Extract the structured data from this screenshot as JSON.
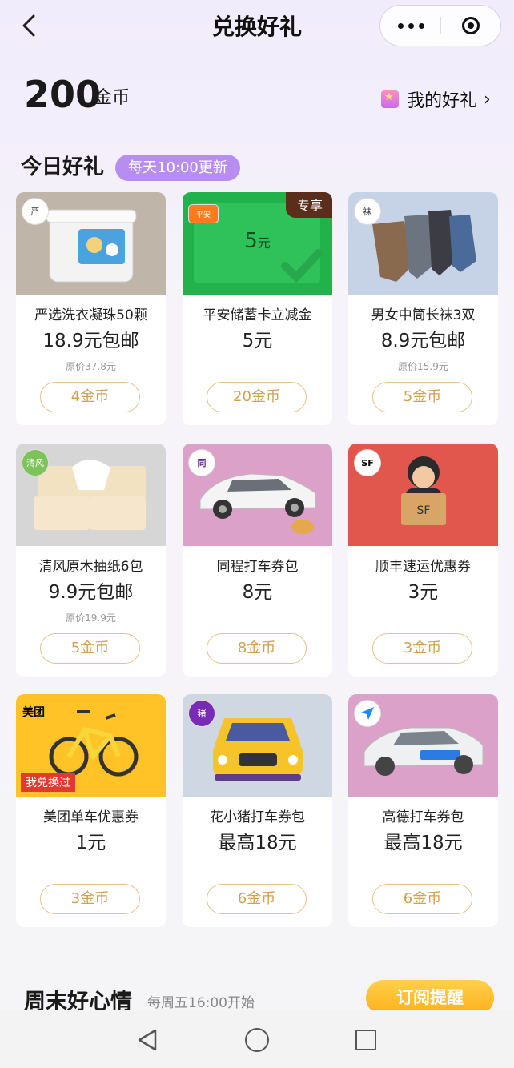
{
  "header": {
    "title": "兑换好礼"
  },
  "balance": {
    "amount": "200",
    "unit": "金币",
    "my_gifts_label": "我的好礼"
  },
  "section_today": {
    "title": "今日好礼",
    "badge": "每天10:00更新"
  },
  "products": [
    {
      "name": "严选洗衣凝珠50颗",
      "price": "18.9元包邮",
      "original": "原价37.8元",
      "cost": "4金币",
      "bg": "#bfb5a8"
    },
    {
      "name": "平安储蓄卡立减金",
      "price": "5元",
      "original": "",
      "cost": "20金币",
      "badge": "专享",
      "bg": "#22b24c",
      "voucher": "5",
      "voucher_unit": "元"
    },
    {
      "name": "男女中筒长袜3双",
      "price": "8.9元包邮",
      "original": "原价15.9元",
      "cost": "5金币",
      "bg": "#c6d2e6"
    },
    {
      "name": "清风原木抽纸6包",
      "price": "9.9元包邮",
      "original": "原价19.9元",
      "cost": "5金币",
      "bg": "#d6d6d6"
    },
    {
      "name": "同程打车券包",
      "price": "8元",
      "original": "",
      "cost": "8金币",
      "bg": "#dba1c9"
    },
    {
      "name": "顺丰速运优惠券",
      "price": "3元",
      "original": "",
      "cost": "3金币",
      "bg": "#e2574d"
    },
    {
      "name": "美团单车优惠券",
      "price": "1元",
      "original": "",
      "cost": "3金币",
      "badge": "我兑换过",
      "logo": "美团",
      "bg": "#ffc227"
    },
    {
      "name": "花小猪打车券包",
      "price": "最高18元",
      "original": "",
      "cost": "6金币",
      "bg": "#cfd7e2"
    },
    {
      "name": "高德打车券包",
      "price": "最高18元",
      "original": "",
      "cost": "6金币",
      "bg": "#dba1c9"
    }
  ],
  "section_weekend": {
    "title": "周末好心情",
    "subtitle": "每周五16:00开始",
    "button": "订阅提醒"
  }
}
